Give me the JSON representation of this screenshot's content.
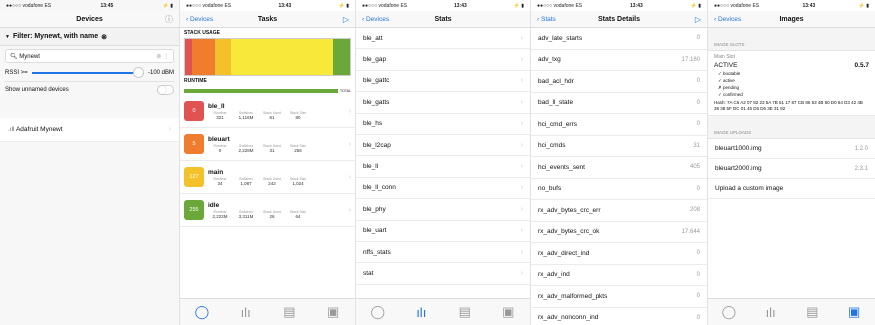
{
  "status": {
    "carrier": "●●○○○ vodafone ES",
    "wifi": "ᯤ",
    "batt": "⚡ ▮",
    "times": [
      "13:45",
      "13:43",
      "13:43",
      "13:43",
      "13:43"
    ]
  },
  "devices": {
    "title": "Devices",
    "info_icon": "ⓘ",
    "filter_label": "Filter: Mynewt, with name",
    "search_value": "Mynewt",
    "rssi_label": "RSSI >=",
    "rssi_value": "-100 dBM",
    "unnamed_label": "Show unnamed devices",
    "device_name": "Adafruit Mynewt"
  },
  "tasks": {
    "back": "Devices",
    "title": "Tasks",
    "stack_label": "STACK USAGE",
    "runtime_label": "RUNTIME",
    "runtime_total": "TOTAL",
    "stat_labels": [
      "Runtime",
      "Switches",
      "Stack Used",
      "Stack Size"
    ],
    "items": [
      {
        "id": "0",
        "name": "ble_ll",
        "runtime": "321",
        "switches": "1,116M",
        "used": "61",
        "size": "80",
        "color": "#e05353"
      },
      {
        "id": "5",
        "name": "bleuart",
        "runtime": "0",
        "switches": "2,228M",
        "used": "31",
        "size": "256",
        "color": "#f07d2e"
      },
      {
        "id": "127",
        "name": "main",
        "runtime": "34",
        "switches": "1,087",
        "used": "242",
        "size": "1,024",
        "color": "#f3c12a"
      },
      {
        "id": "255",
        "name": "idle",
        "runtime": "2,222M",
        "switches": "3,311M",
        "used": "26",
        "size": "64",
        "color": "#6aa83a"
      }
    ]
  },
  "stats": {
    "back": "Devices",
    "title": "Stats",
    "items": [
      "ble_att",
      "ble_gap",
      "ble_gattc",
      "ble_gatts",
      "ble_hs",
      "ble_l2cap",
      "ble_ll",
      "ble_ll_conn",
      "ble_phy",
      "ble_uart",
      "nffs_stats",
      "stat"
    ]
  },
  "details": {
    "back": "Stats",
    "title": "Stats Details",
    "rows": [
      {
        "name": "adv_late_starts",
        "value": "0"
      },
      {
        "name": "adv_txg",
        "value": "17.160"
      },
      {
        "name": "bad_acl_hdr",
        "value": "0"
      },
      {
        "name": "bad_ll_state",
        "value": "0"
      },
      {
        "name": "hci_cmd_errs",
        "value": "0"
      },
      {
        "name": "hci_cmds",
        "value": "31"
      },
      {
        "name": "hci_events_sent",
        "value": "405"
      },
      {
        "name": "no_bufs",
        "value": "0"
      },
      {
        "name": "rx_adv_bytes_crc_err",
        "value": "208"
      },
      {
        "name": "rx_adv_bytes_crc_ok",
        "value": "17.644"
      },
      {
        "name": "rx_adv_direct_ind",
        "value": "0"
      },
      {
        "name": "rx_adv_ind",
        "value": "0"
      },
      {
        "name": "rx_adv_malformed_pkts",
        "value": "0"
      },
      {
        "name": "rx_adv_nonconn_ind",
        "value": "0"
      }
    ]
  },
  "images": {
    "back": "Devices",
    "title": "Images",
    "slots_header": "IMAGE SLOTS",
    "main_slot": "Main Slot",
    "active": "ACTIVE",
    "version": "0.5.7",
    "flags": [
      "✓ bootable",
      "✓ active",
      "✗ pending",
      "✓ confirmed"
    ],
    "hash": "Hash: 7A C6 A2 07 82 23 5A 7B 61 17 87 CB 86 53 4B 80 D0 64 D3 42 4B 38 38 5F DC 01 45 D5 D6 3E 31 92",
    "uploads_header": "IMAGE UPLOADS",
    "uploads": [
      {
        "name": "bleuart1000.img",
        "version": "1.2.0"
      },
      {
        "name": "bleuart2000.img",
        "version": "2.3.1"
      }
    ],
    "custom": "Upload a custom image"
  },
  "tabbar": {
    "icons": [
      "◯",
      "ılı",
      "▤",
      "▣"
    ]
  },
  "colors": {
    "accent": "#1f73e5",
    "stack_yellow": "#f7e83a",
    "runtime_green": "#6aa83a"
  }
}
